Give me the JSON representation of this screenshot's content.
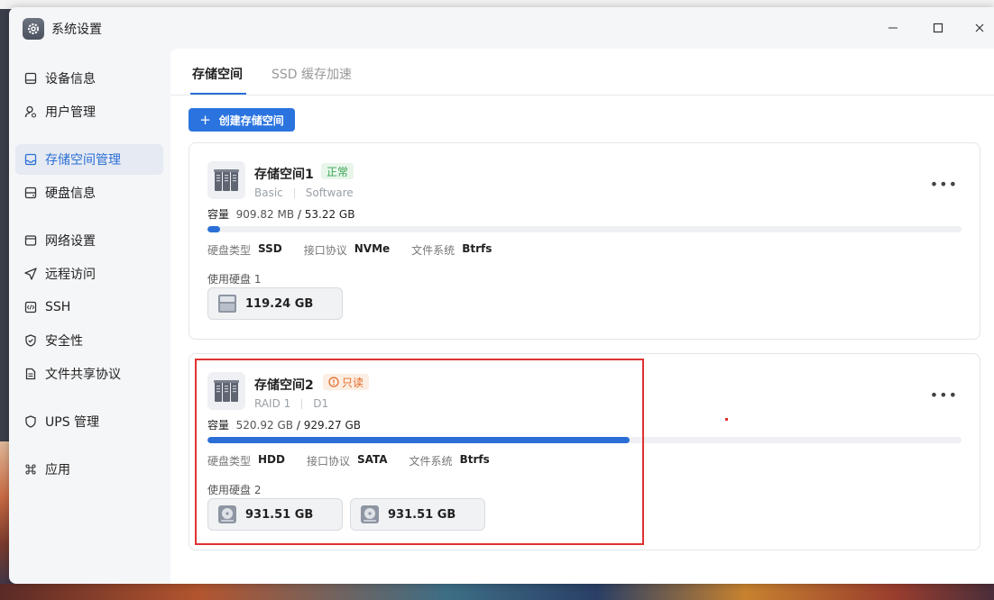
{
  "window": {
    "title": "系统设置"
  },
  "sidebar": {
    "items": [
      {
        "label": "设备信息",
        "icon": "device-icon"
      },
      {
        "label": "用户管理",
        "icon": "user-icon"
      },
      {
        "label": "存储空间管理",
        "icon": "storage-icon",
        "active": true
      },
      {
        "label": "硬盘信息",
        "icon": "harddisk-icon"
      },
      {
        "label": "网络设置",
        "icon": "network-icon"
      },
      {
        "label": "远程访问",
        "icon": "remote-icon"
      },
      {
        "label": "SSH",
        "icon": "code-icon"
      },
      {
        "label": "安全性",
        "icon": "shield-icon"
      },
      {
        "label": "文件共享协议",
        "icon": "file-icon"
      },
      {
        "label": "UPS 管理",
        "icon": "ups-shield-icon"
      },
      {
        "label": "应用",
        "icon": "command-icon"
      }
    ]
  },
  "tabs": [
    {
      "label": "存储空间",
      "active": true
    },
    {
      "label": "SSD 缓存加速"
    }
  ],
  "create_button": {
    "label": "创建存储空间"
  },
  "labels": {
    "capacity": "容量",
    "disk_type": "硬盘类型",
    "protocol": "接口协议",
    "filesystem": "文件系统",
    "used_disks": "使用硬盘"
  },
  "spaces": [
    {
      "name": "存储空间1",
      "status": "正常",
      "level": "Basic",
      "detail": "Software",
      "used": "909.82 MB",
      "total": "53.22 GB",
      "usage_fraction": 0.017,
      "disk_type": "SSD",
      "protocol": "NVMe",
      "filesystem": "Btrfs",
      "disk_count": "1",
      "disks": [
        {
          "size": "119.24 GB",
          "kind": "nvme"
        }
      ]
    },
    {
      "name": "存储空间2",
      "status": "只读",
      "level": "RAID 1",
      "detail": "D1",
      "used": "520.92 GB",
      "total": "929.27 GB",
      "usage_fraction": 0.56,
      "disk_type": "HDD",
      "protocol": "SATA",
      "filesystem": "Btrfs",
      "disk_count": "2",
      "disks": [
        {
          "size": "931.51 GB",
          "kind": "hdd"
        },
        {
          "size": "931.51 GB",
          "kind": "hdd"
        }
      ]
    }
  ],
  "colors": {
    "accent": "#2b6fd6",
    "ok": "#3aa657",
    "readonly": "#e26a25",
    "highlight": "#e03131"
  }
}
